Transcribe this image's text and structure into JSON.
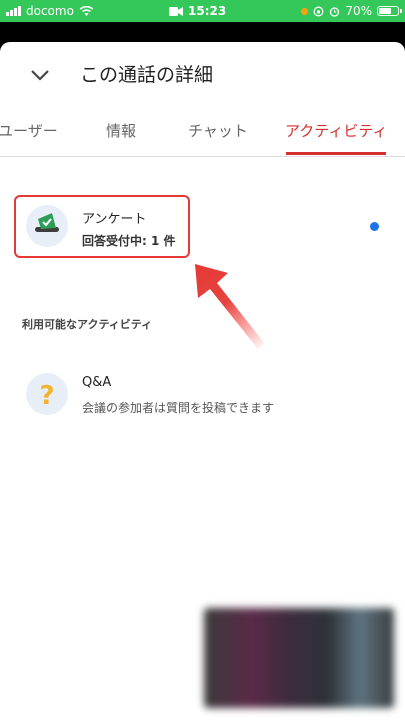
{
  "status_bar": {
    "carrier": "docomo",
    "time": "15:23",
    "battery": "70%",
    "battery_level": 0.7
  },
  "header": {
    "title": "この通話の詳細"
  },
  "tabs": [
    {
      "label": "ユーザー"
    },
    {
      "label": "情報"
    },
    {
      "label": "チャット"
    },
    {
      "label": "アクティビティ",
      "active": true
    }
  ],
  "activities": {
    "poll": {
      "title": "アンケート",
      "status": "回答受付中: 1 件"
    }
  },
  "available": {
    "section_label": "利用可能なアクティビティ",
    "qa": {
      "title": "Q&A",
      "description": "会議の参加者は質問を投稿できます"
    }
  },
  "colors": {
    "accent": "#d32f2f",
    "status_bar": "#34c759",
    "annotation": "#e53935",
    "unread_dot": "#1a73e8"
  }
}
